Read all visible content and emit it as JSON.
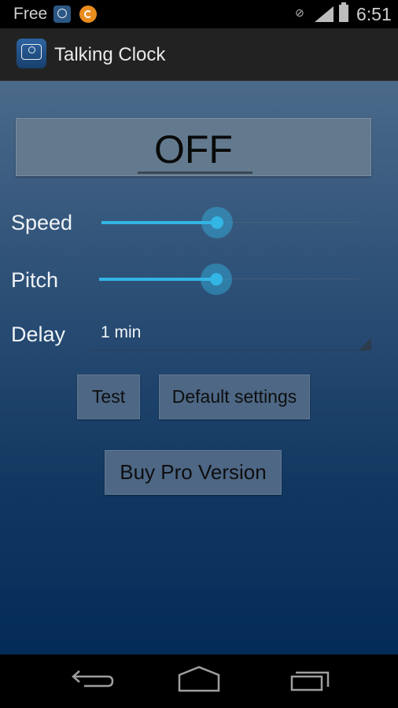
{
  "status_bar": {
    "carrier_text": "Free",
    "notification_icons": [
      "talking-clock-app-icon",
      "orange-app-icon"
    ],
    "system_icons": [
      "alarm-icon",
      "signal-icon",
      "battery-icon"
    ],
    "time": "6:51"
  },
  "action_bar": {
    "app_icon": "talking-clock-icon",
    "title": "Talking Clock"
  },
  "main": {
    "toggle_label": "OFF",
    "speed": {
      "label": "Speed",
      "value_percent": 45
    },
    "pitch": {
      "label": "Pitch",
      "value_percent": 45
    },
    "delay": {
      "label": "Delay",
      "selected": "1 min"
    },
    "buttons": {
      "test": "Test",
      "default_settings": "Default settings",
      "buy_pro": "Buy Pro Version"
    }
  },
  "nav_bar": {
    "buttons": [
      "back-icon",
      "home-icon",
      "recents-icon"
    ]
  },
  "colors": {
    "accent": "#33b5e5",
    "background_top": "#4b6a8a",
    "background_bottom": "#042b58"
  }
}
